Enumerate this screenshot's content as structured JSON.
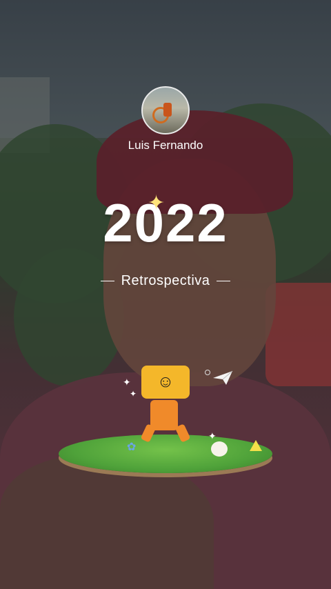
{
  "profile": {
    "name": "Luis Fernando"
  },
  "story": {
    "year": "2022",
    "subtitle": "Retrospectiva",
    "mascot_face": "☺"
  },
  "icons": {
    "sparkle_icon": "✦",
    "paper_plane_icon": "paper-plane-icon",
    "flower_icon": "✿"
  }
}
